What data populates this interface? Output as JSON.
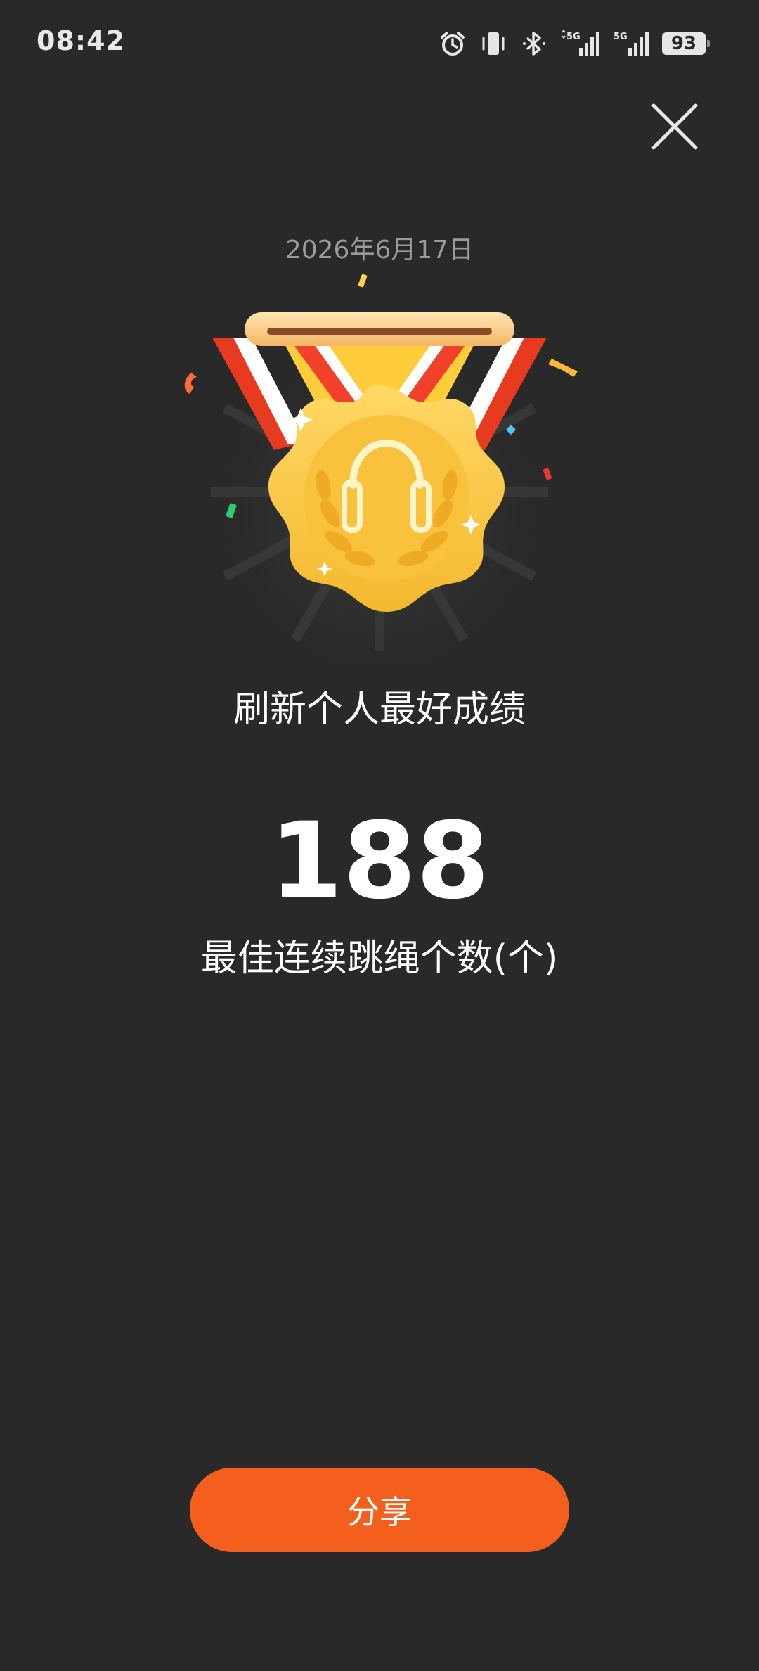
{
  "status_bar": {
    "time": "08:42",
    "battery": "93",
    "icons": [
      "alarm-icon",
      "vibrate-icon",
      "bluetooth-icon",
      "signal-5g-icon",
      "signal-5g-icon"
    ]
  },
  "close_icon": "close-icon",
  "date": "2026年6月17日",
  "medal_icon": "jump-rope-medal-icon",
  "headline": "刷新个人最好成绩",
  "record": {
    "value": "188",
    "label": "最佳连续跳绳个数(个)"
  },
  "share_button": {
    "label": "分享"
  },
  "colors": {
    "background": "#292929",
    "accent": "#f45f1e",
    "medal_gold": "#f7c948",
    "date_text": "#9b9b9b"
  }
}
